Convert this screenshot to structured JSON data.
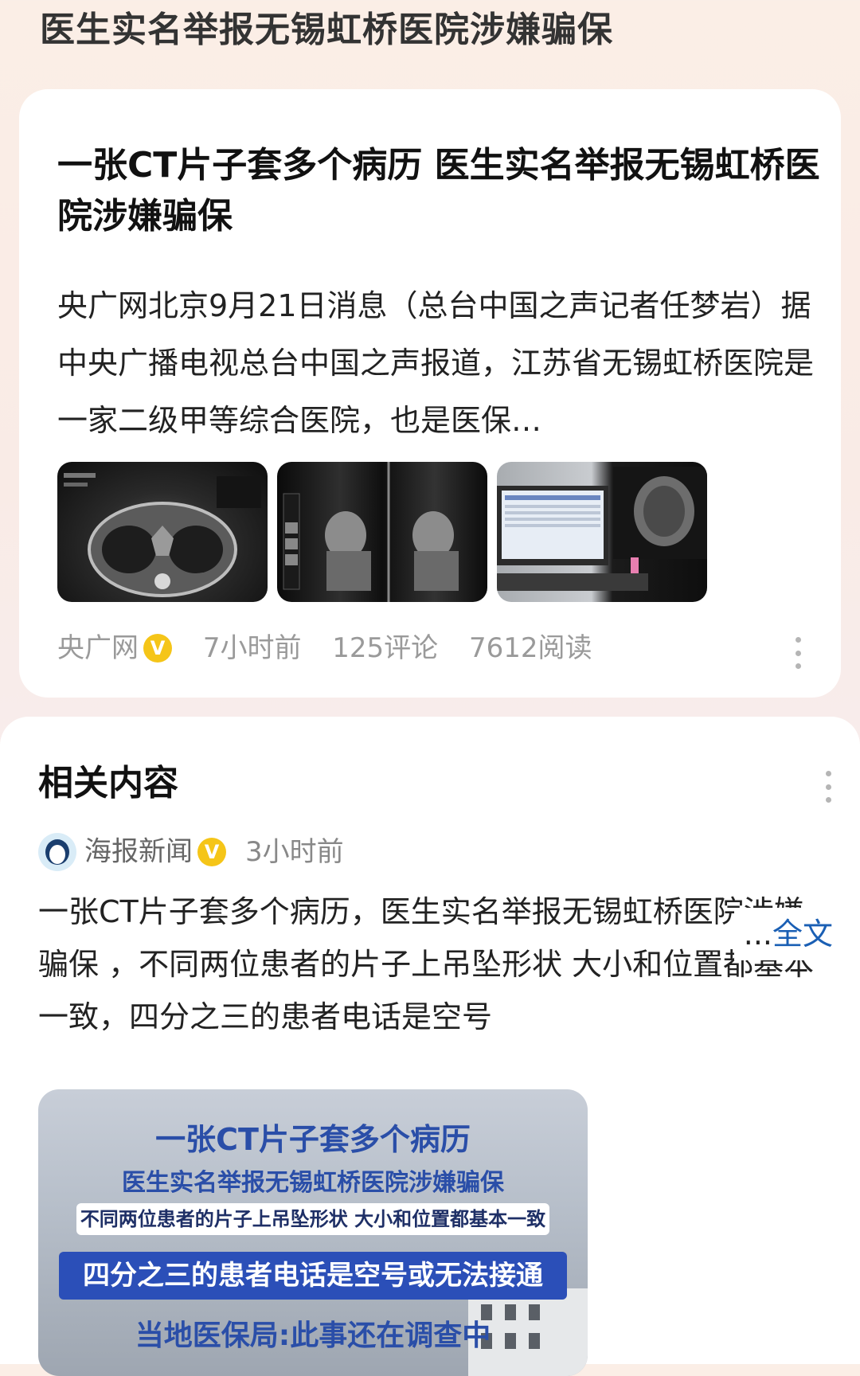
{
  "header": {
    "title": "医生实名举报无锡虹桥医院涉嫌骗保"
  },
  "article": {
    "title": "一张CT片子套多个病历 医生实名举报无锡虹桥医院涉嫌骗保",
    "summary": "央广网北京9月21日消息（总台中国之声记者任梦岩）据中央广播电视总台中国之声报道，江苏省无锡虹桥医院是一家二级甲等综合医院，也是医保…",
    "images": [
      {
        "icon": "ct-scan-image"
      },
      {
        "icon": "xray-film-image"
      },
      {
        "icon": "computer-monitor-image"
      }
    ],
    "source": "央广网",
    "verified_badge": "V",
    "time": "7小时前",
    "comments": "125评论",
    "reads": "7612阅读"
  },
  "related": {
    "heading": "相关内容",
    "item": {
      "source": "海报新闻",
      "verified_badge": "V",
      "time": "3小时前",
      "text": "一张CT片子套多个病历，医生实名举报无锡虹桥医院涉嫌骗保 ，不同两位患者的片子上吊坠形状 大小和位置都基本一致，四分之三的患者电话是空号",
      "ellipsis": "...",
      "full_link": "全文",
      "video_lines": [
        "一张CT片子套多个病历",
        "医生实名举报无锡虹桥医院涉嫌骗保",
        "不同两位患者的片子上吊坠形状 大小和位置都基本一致",
        "四分之三的患者电话是空号或无法接通",
        "当地医保局:此事还在调查中"
      ]
    }
  },
  "colors": {
    "accent_link": "#1a5fb4",
    "badge": "#f5c518",
    "video_text": "#2a4ea8"
  }
}
